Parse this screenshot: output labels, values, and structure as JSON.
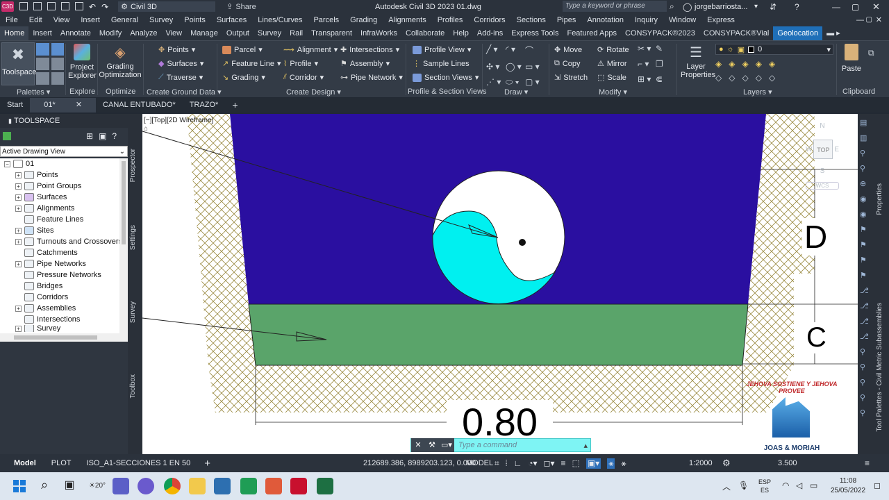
{
  "titlebar": {
    "app_badge": "C3D",
    "workspace": "Civil 3D",
    "share": "Share",
    "title": "Autodesk Civil 3D 2023    01.dwg",
    "search_placeholder": "Type a keyword or phrase",
    "user": "jorgebarriosta..."
  },
  "menu": [
    "File",
    "Edit",
    "View",
    "Insert",
    "General",
    "Survey",
    "Points",
    "Surfaces",
    "Lines/Curves",
    "Parcels",
    "Grading",
    "Alignments",
    "Profiles",
    "Corridors",
    "Sections",
    "Pipes",
    "Annotation",
    "Inquiry",
    "Window",
    "Express"
  ],
  "ribbon_tabs": [
    "Home",
    "Insert",
    "Annotate",
    "Modify",
    "Analyze",
    "View",
    "Manage",
    "Output",
    "Survey",
    "Rail",
    "Transparent",
    "InfraWorks",
    "Collaborate",
    "Help",
    "Add-ins",
    "Express Tools",
    "Featured Apps",
    "CONSYPACK®2023",
    "CONSYPACK®Vial",
    "Geolocation"
  ],
  "ribbon": {
    "toolspace": "Toolspace",
    "project_explorer": [
      "Project",
      "Explorer"
    ],
    "grading_opt": [
      "Grading",
      "Optimization"
    ],
    "ground": [
      "Points",
      "Surfaces",
      "Traverse"
    ],
    "design1": [
      "Parcel",
      "Feature Line",
      "Grading"
    ],
    "design2": [
      "Alignment",
      "Profile",
      "Corridor"
    ],
    "design3": [
      "Intersections",
      "Assembly",
      "Pipe Network"
    ],
    "profile": [
      "Profile View",
      "Sample Lines",
      "Section Views"
    ],
    "modify1": [
      "Move",
      "Copy",
      "Stretch"
    ],
    "modify2": [
      "Rotate",
      "Mirror",
      "Scale"
    ],
    "layer_props": [
      "Layer",
      "Properties"
    ],
    "layer_value": "0",
    "paste": "Paste",
    "panels": [
      "Palettes",
      "Explore",
      "Optimize",
      "Create Ground Data",
      "Create Design",
      "Profile & Section Views",
      "Draw",
      "Modify",
      "Layers",
      "Clipboard"
    ]
  },
  "doc_tabs": [
    "Start",
    "01*",
    "CANAL ENTUBADO*",
    "TRAZO*"
  ],
  "toolspace": {
    "title": "TOOLSPACE",
    "view": "Active Drawing View",
    "root": "01",
    "items": [
      "Points",
      "Point Groups",
      "Surfaces",
      "Alignments",
      "Feature Lines",
      "Sites",
      "Turnouts and Crossovers",
      "Catchments",
      "Pipe Networks",
      "Pressure Networks",
      "Bridges",
      "Corridors",
      "Assemblies",
      "Intersections",
      "Survey"
    ],
    "side_tabs": [
      "Prospector",
      "Settings",
      "Survey",
      "Toolbox"
    ]
  },
  "canvas": {
    "viewport_label": "[−][Top][2D Wireframe]",
    "dim_D": "D",
    "dim_C": "C",
    "dim_width": "0.80",
    "viewcube_top": "TOP",
    "viewcube_n": "N",
    "viewcube_w": "W",
    "viewcube_e": "E",
    "viewcube_s": "S",
    "wcs": "WCS",
    "command_placeholder": "Type a command",
    "logo_top": "JEHOVA SOSTIENE Y JEHOVA PROVEE",
    "logo_bottom": "JOAS & MORIAH",
    "colors": {
      "water": "#2a0fa0",
      "fill": "#5aa46a",
      "pipe_water": "#00f0f0",
      "hatch": "#9a8a40"
    }
  },
  "right_tabs": [
    "Properties",
    "Tool Palettes - Civil Metric Subassemblies"
  ],
  "status": {
    "layouts": [
      "Model",
      "PLOT",
      "ISO_A1-SECCIONES 1 EN 50"
    ],
    "coords": "212689.386, 8989203.123, 0.000",
    "mode": "MODEL",
    "scale": "1:2000",
    "value": "3.500"
  },
  "taskbar": {
    "weather": "20°",
    "lang": [
      "ESP",
      "ES"
    ],
    "time": "11:08",
    "date": "25/05/2022"
  }
}
